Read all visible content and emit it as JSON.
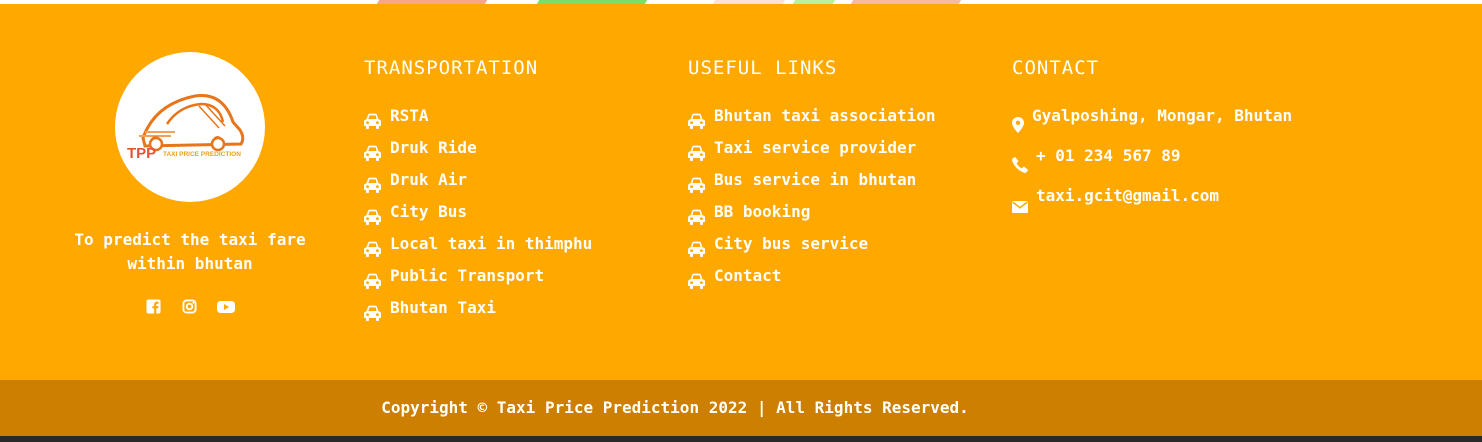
{
  "brand": {
    "logo_initials": "TPP",
    "logo_text": "TAXI PRICE PREDICTION",
    "tagline_line1": "To predict the taxi fare",
    "tagline_line2": "within bhutan",
    "social": [
      "facebook-icon",
      "instagram-icon",
      "youtube-icon"
    ]
  },
  "transportation": {
    "title": "TRANSPORTATION",
    "items": [
      "RSTA",
      "Druk Ride",
      "Druk Air",
      "City Bus",
      "Local taxi in thimphu",
      "Public Transport",
      "Bhutan Taxi"
    ]
  },
  "useful_links": {
    "title": "USEFUL LINKS",
    "items": [
      "Bhutan taxi association",
      "Taxi service provider",
      "Bus service in bhutan",
      "BB booking",
      "City bus service",
      "Contact"
    ]
  },
  "contact": {
    "title": "CONTACT",
    "address": "Gyalposhing, Mongar, Bhutan",
    "phone": "+ 01 234 567 89",
    "email": "taxi.gcit@gmail.com"
  },
  "footer": {
    "copyright": "Copyright © Taxi Price Prediction 2022 | All Rights Reserved."
  },
  "colors": {
    "footer_bg": "#FFA800",
    "bottom_bg": "#CC7F00",
    "text": "#FFFFFF",
    "logo_orange": "#E8751A"
  }
}
